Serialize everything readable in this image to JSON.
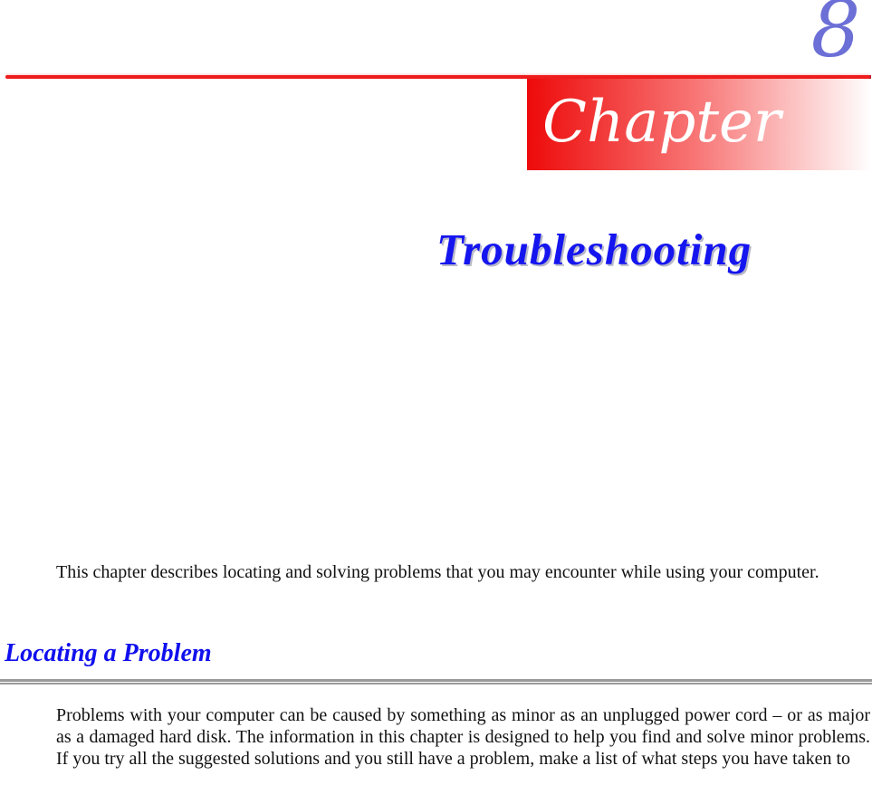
{
  "header": {
    "chapter_number": "8",
    "chapter_label": "Chapter",
    "accent_red": "#ee1c1c",
    "number_color": "#6b6fd6"
  },
  "title": {
    "text": "Troubleshooting",
    "color": "#1515ef"
  },
  "intro": {
    "text": "This chapter describes locating and solving problems that you may encounter while using your computer."
  },
  "sections": [
    {
      "heading": "Locating a Problem",
      "heading_color": "#1010ee",
      "paragraph": "Problems with your computer can be caused by something as minor as an unplugged power cord – or as major as a damaged hard disk. The information in this chapter is designed to help you find and solve minor problems. If you try all the suggested solutions and you still have a problem, make a list of what steps you have taken to"
    }
  ]
}
